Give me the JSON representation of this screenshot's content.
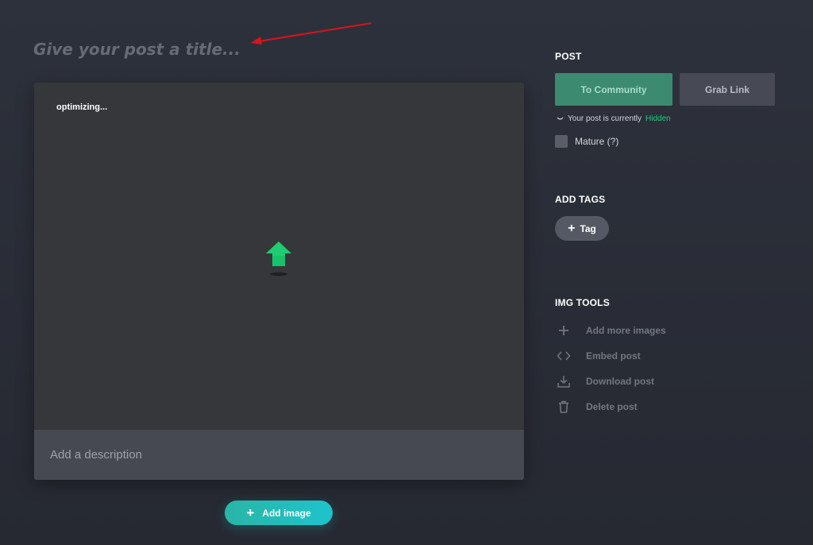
{
  "header": {
    "title_placeholder": "Give your post a title..."
  },
  "editor": {
    "status": "optimizing...",
    "description_placeholder": "Add a description",
    "add_image_label": "Add image"
  },
  "sidebar": {
    "post": {
      "heading": "POST",
      "community_button": "To Community",
      "grab_link_button": "Grab Link",
      "visibility_prefix": "Your post is currently",
      "visibility_state": "Hidden",
      "mature_label": "Mature (?)"
    },
    "tags": {
      "heading": "ADD TAGS",
      "tag_button": "Tag"
    },
    "tools": {
      "heading": "IMG TOOLS",
      "items": [
        {
          "label": "Add more images",
          "icon": "plus-icon"
        },
        {
          "label": "Embed post",
          "icon": "code-icon"
        },
        {
          "label": "Download post",
          "icon": "download-icon"
        },
        {
          "label": "Delete post",
          "icon": "trash-icon"
        }
      ]
    }
  },
  "colors": {
    "accent_green": "#1bd07a",
    "community_button": "#3c8a70",
    "add_image_gradient_start": "#2ab5a7",
    "add_image_gradient_end": "#1fc3cc",
    "annotation_arrow": "#d9141b"
  }
}
